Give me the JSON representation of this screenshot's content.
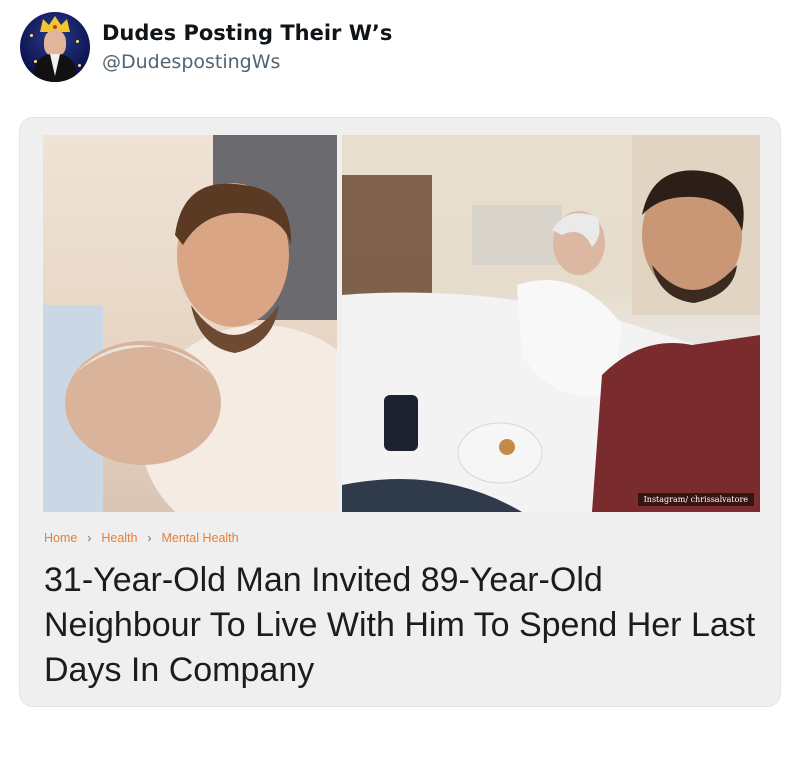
{
  "tweet": {
    "author_name": "Dudes Posting Their W’s",
    "author_handle": "@DudespostingWs"
  },
  "article": {
    "photo_credit": "Instagram/ chrissalvatore",
    "breadcrumb": [
      "Home",
      "Health",
      "Mental Health"
    ],
    "breadcrumb_separator": "›",
    "headline": "31-Year-Old Man Invited 89-Year-Old Neighbour To Live With Him To Spend Her Last Days In Company"
  },
  "colors": {
    "breadcrumb": "#e67e3a",
    "card_background": "#efefef",
    "handle": "#536471"
  }
}
